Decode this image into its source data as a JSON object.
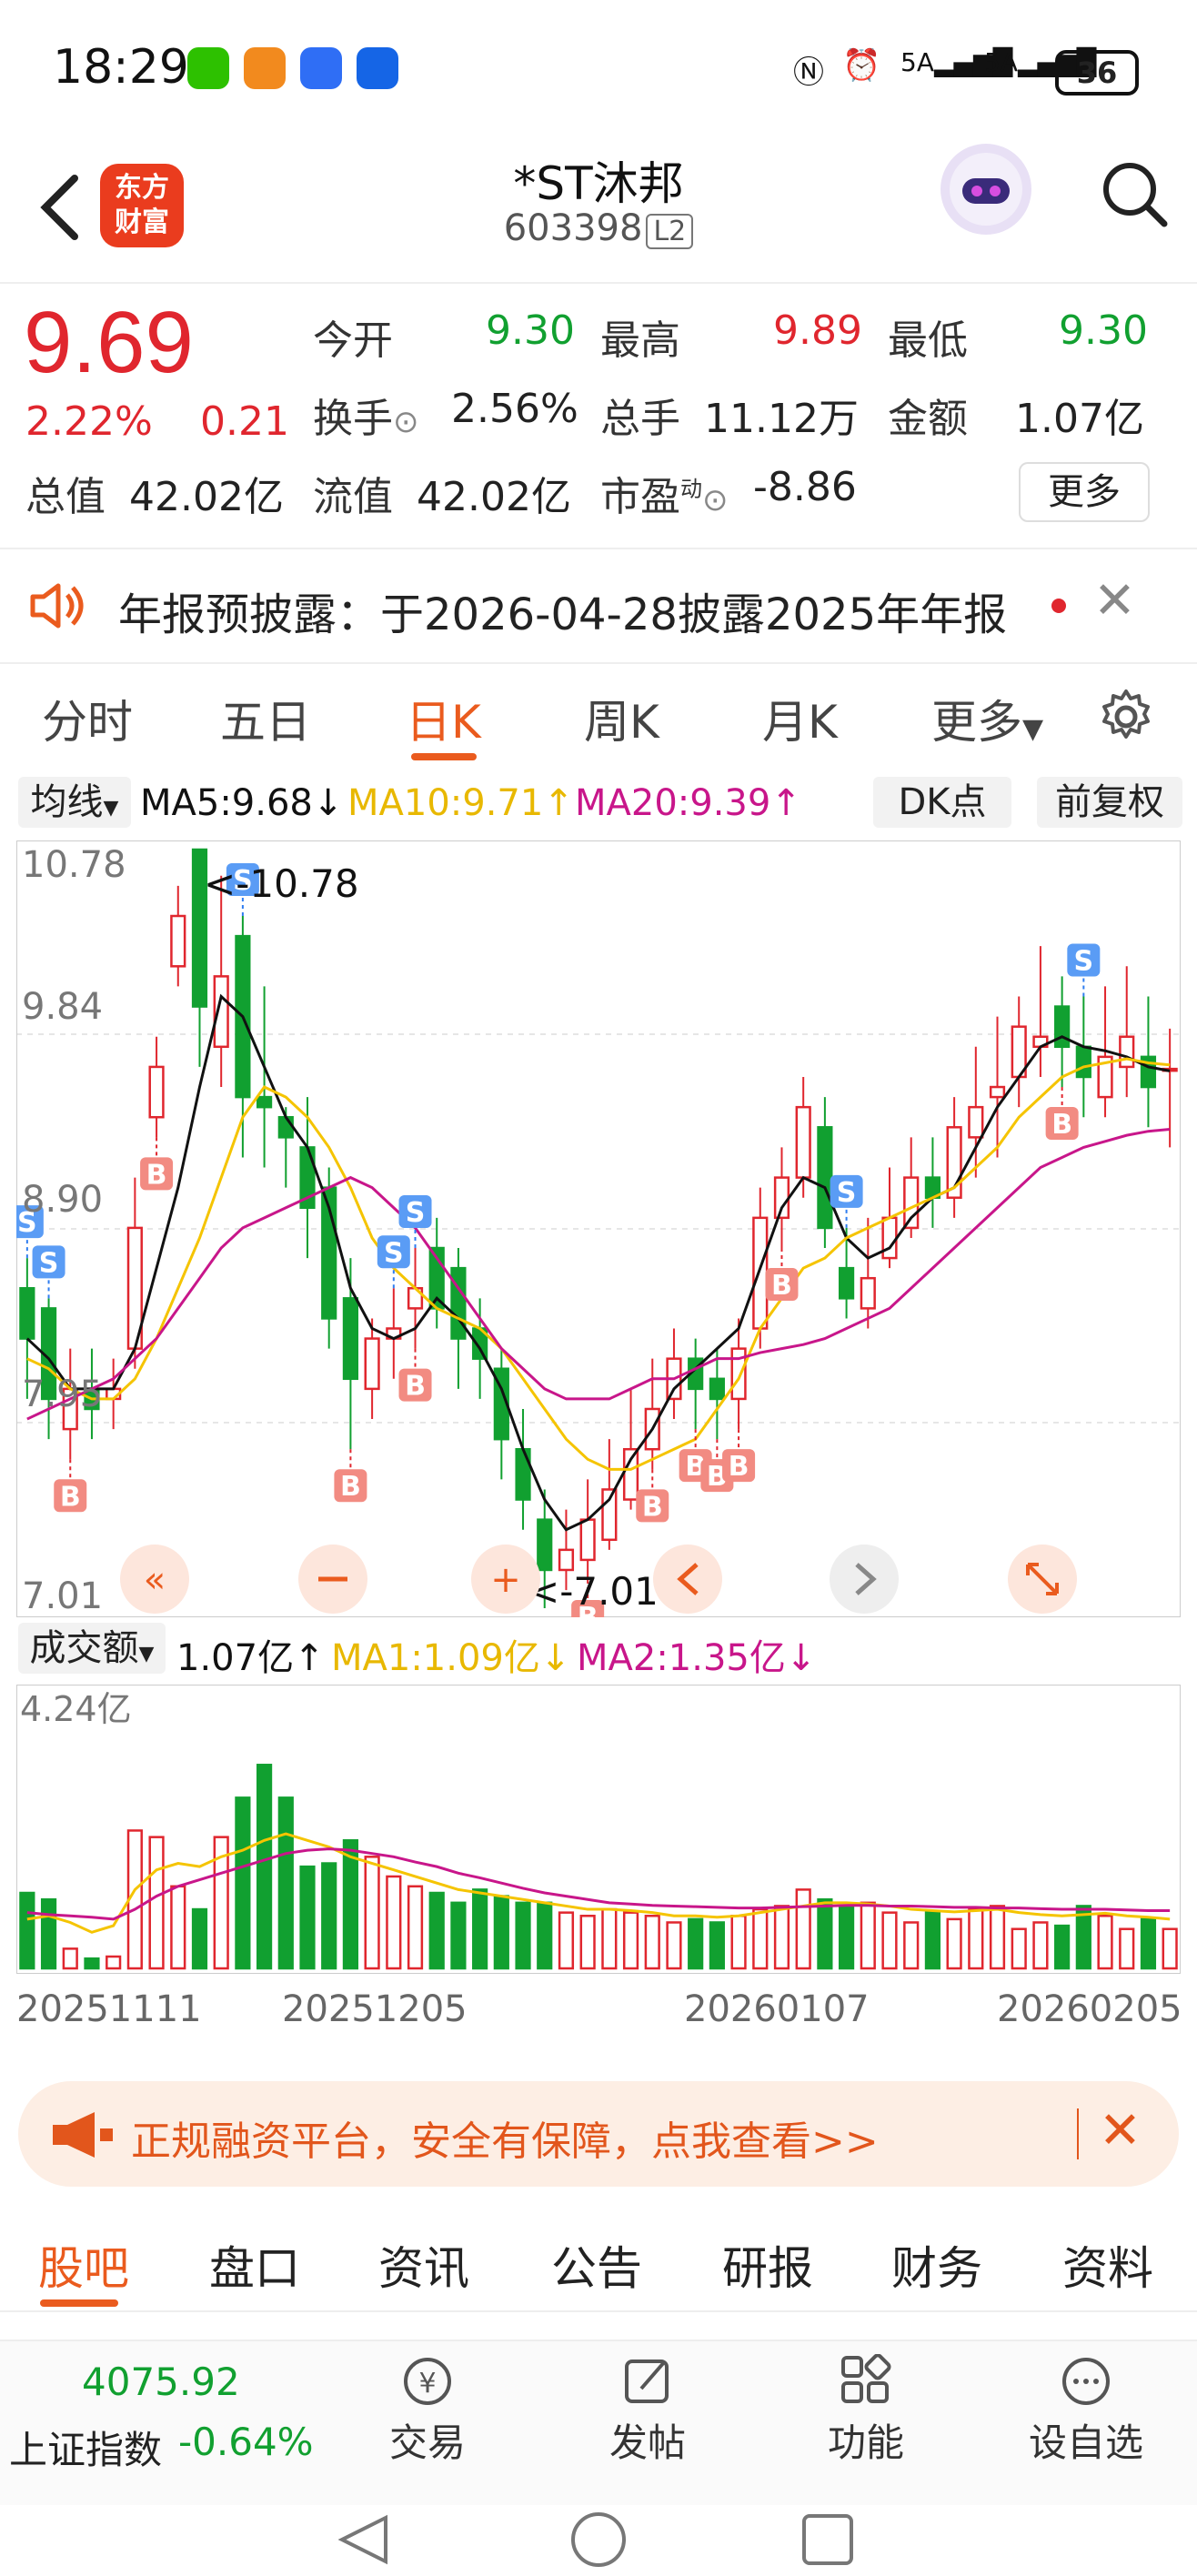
{
  "status_bar": {
    "time": "18:29",
    "network1": "5A",
    "network2": "5A",
    "battery": "36"
  },
  "header": {
    "title": "*ST沐邦",
    "code": "603398",
    "badge": "L2",
    "logo_line1": "东方",
    "logo_line2": "财富"
  },
  "quote": {
    "price": "9.69",
    "change_pct": "2.22%",
    "change": "0.21",
    "fields": [
      {
        "label": "今开",
        "value": "9.30",
        "color": "green"
      },
      {
        "label": "最高",
        "value": "9.89",
        "color": "red"
      },
      {
        "label": "最低",
        "value": "9.30",
        "color": "green"
      },
      {
        "label": "换手",
        "value": "2.56%",
        "color": "dark"
      },
      {
        "label": "总手",
        "value": "11.12万",
        "color": "dark"
      },
      {
        "label": "金额",
        "value": "1.07亿",
        "color": "dark"
      },
      {
        "label": "总值",
        "value": "42.02亿",
        "color": "dark"
      },
      {
        "label": "流值",
        "value": "42.02亿",
        "color": "dark"
      },
      {
        "label": "市盈",
        "value": "-8.86",
        "color": "dark"
      }
    ],
    "pe_superscript": "动",
    "more_label": "更多"
  },
  "notice": {
    "text": "年报预披露：于2026-04-28披露2025年年报"
  },
  "k_tabs": {
    "items": [
      "分时",
      "五日",
      "日K",
      "周K",
      "月K",
      "更多"
    ],
    "active": "日K"
  },
  "ma_row": {
    "selector": "均线",
    "ma5": "MA5:9.68",
    "ma10": "MA10:9.71",
    "ma20": "MA20:9.39",
    "dk": "DK点",
    "adjust": "前复权"
  },
  "colors": {
    "up": "#e0262e",
    "down": "#11a030",
    "ma5": "#111111",
    "ma10": "#f5c400",
    "ma20": "#c8168a",
    "accent": "#ea5b1e"
  },
  "chart_labels": {
    "y_top": "10.78",
    "y_2": "9.84",
    "y_3": "8.90",
    "y_4": "7.95",
    "y_bottom": "7.01",
    "max_mark": "<-10.78",
    "min_mark": "<-7.01",
    "vol_max": "4.24亿"
  },
  "chart_data": {
    "type": "bar",
    "title": "",
    "ylim": [
      7.01,
      10.78
    ],
    "candles": [
      [
        8.6,
        8.35,
        8.05,
        8.75
      ],
      [
        8.5,
        8.05,
        7.85,
        8.55
      ],
      [
        7.9,
        8.1,
        7.75,
        8.3
      ],
      [
        8.1,
        8.0,
        7.85,
        8.3
      ],
      [
        8.05,
        8.1,
        7.9,
        8.25
      ],
      [
        8.3,
        8.9,
        8.2,
        9.15
      ],
      [
        9.45,
        9.7,
        9.35,
        9.85
      ],
      [
        10.2,
        10.45,
        10.1,
        10.6
      ],
      [
        10.78,
        10.0,
        9.7,
        10.78
      ],
      [
        9.8,
        10.15,
        9.6,
        10.65
      ],
      [
        10.35,
        9.55,
        9.25,
        10.45
      ],
      [
        9.55,
        9.5,
        9.2,
        10.1
      ],
      [
        9.45,
        9.35,
        9.1,
        9.5
      ],
      [
        9.3,
        9.0,
        8.75,
        9.55
      ],
      [
        9.1,
        8.45,
        8.3,
        9.2
      ],
      [
        8.55,
        8.15,
        7.8,
        8.75
      ],
      [
        8.1,
        8.35,
        7.95,
        8.45
      ],
      [
        8.35,
        8.4,
        8.15,
        8.6
      ],
      [
        8.5,
        8.6,
        8.3,
        8.8
      ],
      [
        8.8,
        8.5,
        8.4,
        8.95
      ],
      [
        8.7,
        8.35,
        8.1,
        8.8
      ],
      [
        8.4,
        8.25,
        8.05,
        8.55
      ],
      [
        8.2,
        7.85,
        7.65,
        8.3
      ],
      [
        7.8,
        7.55,
        7.4,
        8.0
      ],
      [
        7.45,
        7.2,
        7.01,
        7.6
      ],
      [
        7.2,
        7.3,
        7.1,
        7.5
      ],
      [
        7.25,
        7.45,
        7.15,
        7.65
      ],
      [
        7.35,
        7.6,
        7.3,
        7.85
      ],
      [
        7.55,
        7.8,
        7.5,
        8.1
      ],
      [
        7.8,
        8.0,
        7.7,
        8.25
      ],
      [
        8.05,
        8.25,
        7.95,
        8.4
      ],
      [
        8.25,
        8.1,
        7.9,
        8.35
      ],
      [
        8.15,
        8.05,
        7.85,
        8.3
      ],
      [
        8.05,
        8.3,
        7.9,
        8.45
      ],
      [
        8.4,
        8.95,
        8.3,
        9.1
      ],
      [
        8.95,
        9.15,
        8.8,
        9.3
      ],
      [
        9.15,
        9.5,
        9.05,
        9.65
      ],
      [
        9.4,
        8.9,
        8.8,
        9.55
      ],
      [
        8.7,
        8.55,
        8.45,
        8.9
      ],
      [
        8.5,
        8.65,
        8.4,
        8.95
      ],
      [
        8.75,
        8.95,
        8.7,
        9.2
      ],
      [
        8.9,
        9.15,
        8.85,
        9.35
      ],
      [
        9.15,
        9.05,
        8.9,
        9.35
      ],
      [
        9.05,
        9.4,
        8.95,
        9.55
      ],
      [
        9.35,
        9.5,
        9.15,
        9.8
      ],
      [
        9.55,
        9.6,
        9.25,
        9.95
      ],
      [
        9.65,
        9.9,
        9.5,
        10.05
      ],
      [
        9.8,
        9.85,
        9.65,
        10.3
      ],
      [
        10.0,
        9.8,
        9.6,
        10.15
      ],
      [
        9.8,
        9.65,
        9.45,
        10.05
      ],
      [
        9.55,
        9.75,
        9.45,
        10.1
      ],
      [
        9.7,
        9.85,
        9.55,
        10.2
      ],
      [
        9.75,
        9.6,
        9.4,
        10.05
      ],
      [
        9.69,
        9.69,
        9.3,
        9.89
      ]
    ],
    "ma5": [
      8.35,
      8.25,
      8.1,
      8.1,
      8.1,
      8.3,
      8.7,
      9.1,
      9.6,
      10.05,
      9.95,
      9.7,
      9.45,
      9.3,
      9.0,
      8.6,
      8.4,
      8.35,
      8.4,
      8.55,
      8.45,
      8.3,
      8.1,
      7.8,
      7.55,
      7.4,
      7.45,
      7.55,
      7.75,
      7.9,
      8.1,
      8.2,
      8.3,
      8.4,
      8.7,
      9.0,
      9.15,
      9.1,
      8.85,
      8.75,
      8.8,
      8.95,
      9.05,
      9.1,
      9.3,
      9.5,
      9.65,
      9.8,
      9.85,
      9.8,
      9.78,
      9.75,
      9.7,
      9.68
    ],
    "ma10": [
      8.25,
      8.2,
      8.1,
      8.05,
      8.05,
      8.15,
      8.35,
      8.6,
      8.85,
      9.15,
      9.45,
      9.6,
      9.55,
      9.45,
      9.3,
      9.1,
      8.85,
      8.7,
      8.6,
      8.5,
      8.45,
      8.4,
      8.3,
      8.15,
      8.0,
      7.85,
      7.75,
      7.7,
      7.7,
      7.75,
      7.8,
      7.85,
      8.0,
      8.15,
      8.4,
      8.55,
      8.7,
      8.75,
      8.85,
      8.9,
      8.95,
      9.0,
      9.05,
      9.1,
      9.2,
      9.3,
      9.45,
      9.55,
      9.65,
      9.7,
      9.72,
      9.74,
      9.72,
      9.71
    ],
    "ma20": [
      7.95,
      8.0,
      8.05,
      8.1,
      8.15,
      8.25,
      8.35,
      8.5,
      8.65,
      8.8,
      8.9,
      8.95,
      9.0,
      9.05,
      9.1,
      9.15,
      9.1,
      9.0,
      8.9,
      8.75,
      8.6,
      8.45,
      8.3,
      8.2,
      8.1,
      8.05,
      8.05,
      8.05,
      8.1,
      8.15,
      8.15,
      8.2,
      8.25,
      8.25,
      8.28,
      8.3,
      8.32,
      8.35,
      8.4,
      8.45,
      8.5,
      8.6,
      8.7,
      8.8,
      8.9,
      9.0,
      9.1,
      9.2,
      9.25,
      9.3,
      9.33,
      9.36,
      9.38,
      9.39
    ],
    "volume": [
      1.15,
      1.05,
      0.3,
      0.15,
      0.18,
      2.1,
      2.0,
      1.25,
      0.9,
      2.0,
      2.6,
      3.1,
      2.6,
      1.55,
      1.6,
      1.95,
      1.7,
      1.4,
      1.25,
      1.15,
      1.0,
      1.2,
      1.1,
      1.0,
      1.0,
      0.85,
      0.8,
      0.9,
      0.85,
      0.8,
      0.7,
      0.75,
      0.7,
      0.8,
      0.9,
      0.95,
      1.2,
      1.05,
      0.95,
      1.0,
      0.85,
      0.7,
      0.85,
      0.75,
      0.9,
      0.95,
      0.6,
      0.7,
      0.65,
      0.95,
      0.8,
      0.6,
      0.75,
      0.6
    ],
    "vol_ma1": [
      0.75,
      0.8,
      0.7,
      0.55,
      0.65,
      1.2,
      1.5,
      1.6,
      1.55,
      1.7,
      1.8,
      1.95,
      2.05,
      1.95,
      1.85,
      1.7,
      1.6,
      1.5,
      1.4,
      1.3,
      1.2,
      1.15,
      1.1,
      1.05,
      1.0,
      0.95,
      0.9,
      0.9,
      0.88,
      0.85,
      0.8,
      0.8,
      0.78,
      0.8,
      0.85,
      0.9,
      0.95,
      1.0,
      1.0,
      0.98,
      0.95,
      0.9,
      0.88,
      0.86,
      0.88,
      0.9,
      0.85,
      0.82,
      0.8,
      0.82,
      0.84,
      0.8,
      0.78,
      0.75
    ],
    "vol_ma2": [
      0.85,
      0.82,
      0.8,
      0.78,
      0.75,
      0.9,
      1.1,
      1.25,
      1.35,
      1.45,
      1.55,
      1.65,
      1.75,
      1.8,
      1.82,
      1.8,
      1.75,
      1.7,
      1.62,
      1.55,
      1.45,
      1.38,
      1.3,
      1.22,
      1.15,
      1.1,
      1.05,
      1.0,
      0.98,
      0.96,
      0.95,
      0.94,
      0.93,
      0.92,
      0.92,
      0.93,
      0.94,
      0.95,
      0.96,
      0.96,
      0.95,
      0.95,
      0.94,
      0.93,
      0.93,
      0.92,
      0.92,
      0.91,
      0.9,
      0.9,
      0.9,
      0.89,
      0.88,
      0.88
    ],
    "vol_ylim": [
      0,
      4.24
    ],
    "x_labels": [
      "20251111",
      "20251205",
      "20260107",
      "20260205"
    ],
    "buy_sell_marks": [
      {
        "i": 0,
        "t": "S"
      },
      {
        "i": 1,
        "t": "S"
      },
      {
        "i": 2,
        "t": "B"
      },
      {
        "i": 6,
        "t": "B"
      },
      {
        "i": 10,
        "t": "S"
      },
      {
        "i": 15,
        "t": "B"
      },
      {
        "i": 17,
        "t": "S"
      },
      {
        "i": 18,
        "t": "S"
      },
      {
        "i": 18,
        "t": "B"
      },
      {
        "i": 26,
        "t": "B"
      },
      {
        "i": 29,
        "t": "B"
      },
      {
        "i": 31,
        "t": "B"
      },
      {
        "i": 32,
        "t": "B"
      },
      {
        "i": 33,
        "t": "B"
      },
      {
        "i": 35,
        "t": "B"
      },
      {
        "i": 38,
        "t": "S"
      },
      {
        "i": 48,
        "t": "B"
      },
      {
        "i": 49,
        "t": "S"
      }
    ]
  },
  "vol_row": {
    "selector": "成交额",
    "value": "1.07亿",
    "ma1": "MA1:1.09亿",
    "ma2": "MA2:1.35亿"
  },
  "ad": {
    "text": "正规融资平台，安全有保障，点我查看>>"
  },
  "bottom_tabs": {
    "items": [
      "股吧",
      "盘口",
      "资讯",
      "公告",
      "研报",
      "财务",
      "资料"
    ],
    "active": "股吧"
  },
  "footer": {
    "index_value": "4075.92",
    "index_name": "上证指数",
    "index_pct": "-0.64%",
    "nav": [
      "交易",
      "发帖",
      "功能",
      "设自选"
    ]
  }
}
